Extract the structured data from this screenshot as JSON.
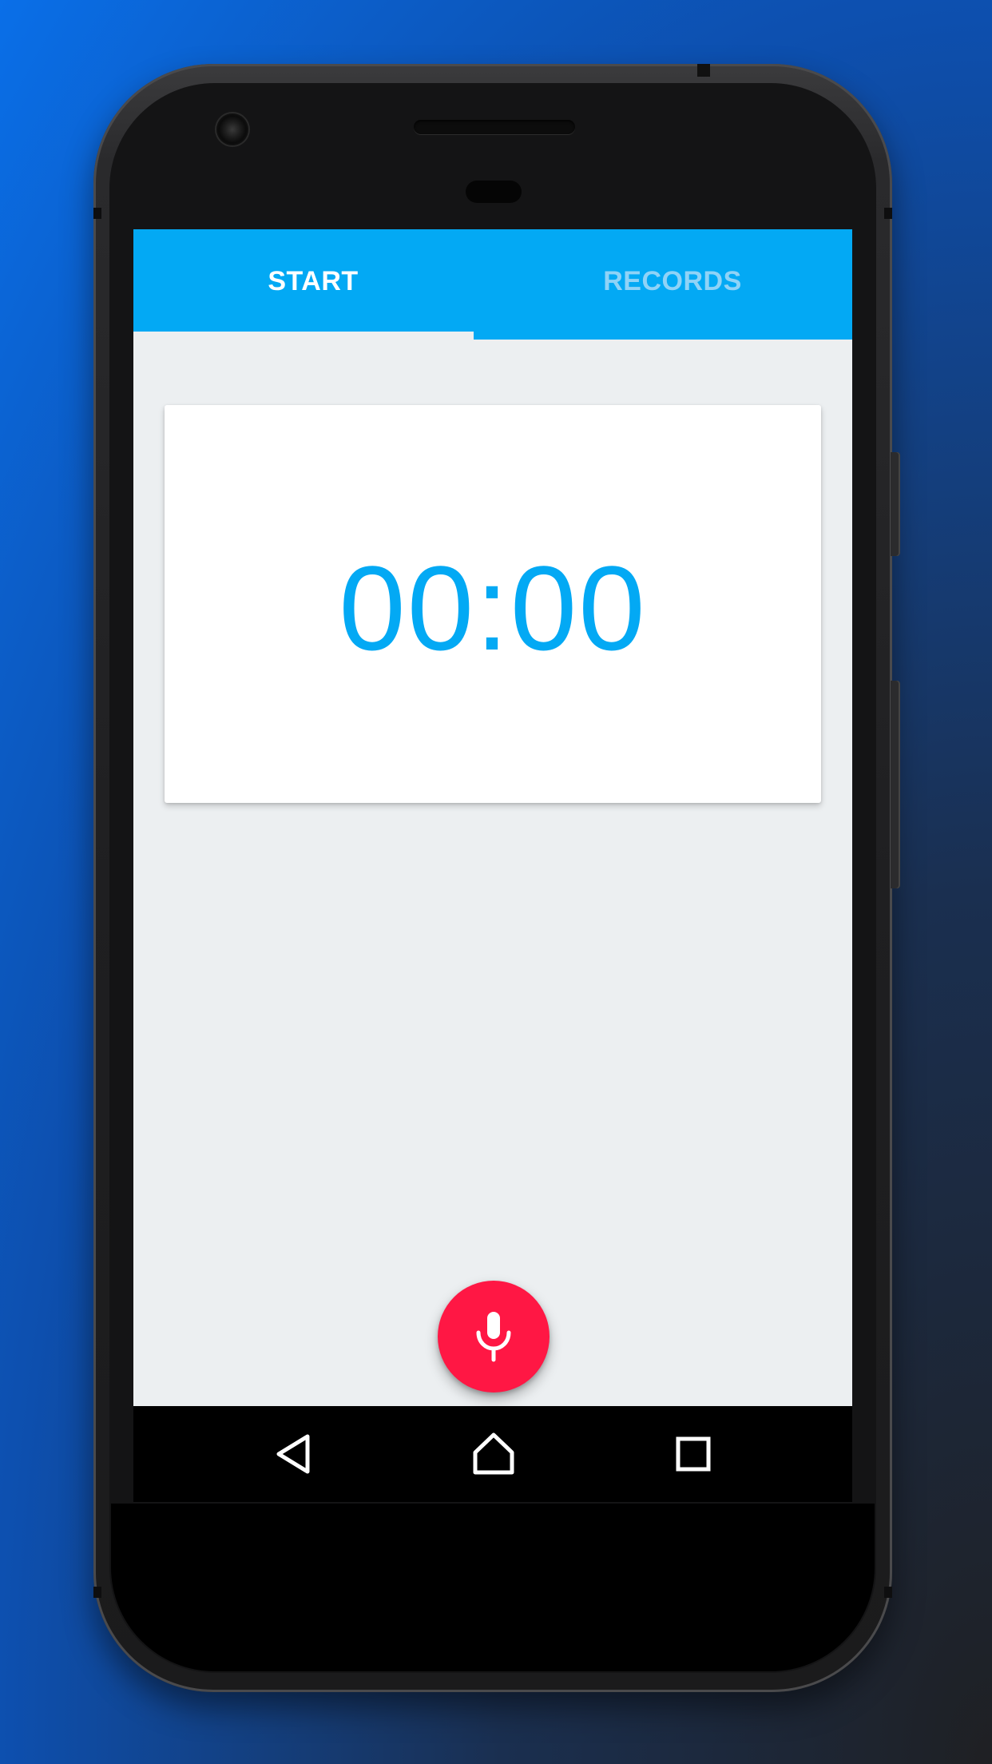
{
  "tabs": [
    {
      "label": "START",
      "selected": true
    },
    {
      "label": "RECORDS",
      "selected": false
    }
  ],
  "timer": {
    "display": "00:00"
  },
  "record_button": {
    "icon": "microphone-icon",
    "color": "#ff1744"
  },
  "navigation": {
    "back_icon": "back-triangle-icon",
    "home_icon": "home-icon",
    "recents_icon": "recents-square-icon"
  },
  "colors": {
    "accent": "#03a9f4",
    "background": "#eceff1",
    "record": "#ff1744"
  }
}
